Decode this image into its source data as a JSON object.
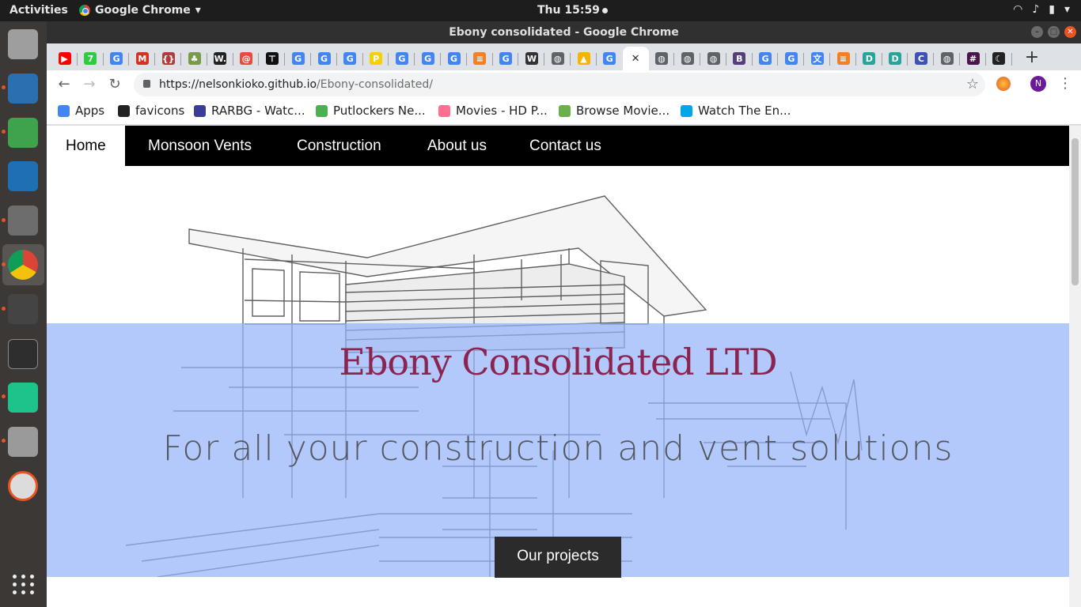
{
  "system": {
    "activities": "Activities",
    "app_name": "Google Chrome",
    "clock": "Thu 15:59"
  },
  "window": {
    "title": "Ebony consolidated - Google Chrome"
  },
  "tabs": [
    {
      "icon": "youtube-icon",
      "color": "#ff0000",
      "glyph": "▶"
    },
    {
      "icon": "green-7-icon",
      "color": "#2ecc40",
      "glyph": "7"
    },
    {
      "icon": "google-icon",
      "color": "#4285f4",
      "glyph": "G"
    },
    {
      "icon": "gmail-icon",
      "color": "#d93025",
      "glyph": "M"
    },
    {
      "icon": "code-icon",
      "color": "#b23b3b",
      "glyph": "{}"
    },
    {
      "icon": "tree-icon",
      "color": "#7a9a4b",
      "glyph": "♣"
    },
    {
      "icon": "w-icon",
      "color": "#222222",
      "glyph": "W."
    },
    {
      "icon": "spiral-icon",
      "color": "#e74c3c",
      "glyph": "@"
    },
    {
      "icon": "network-icon",
      "color": "#111111",
      "glyph": "⊤"
    },
    {
      "icon": "google-icon",
      "color": "#4285f4",
      "glyph": "G"
    },
    {
      "icon": "google-icon",
      "color": "#4285f4",
      "glyph": "G"
    },
    {
      "icon": "google-icon",
      "color": "#4285f4",
      "glyph": "G"
    },
    {
      "icon": "p-icon",
      "color": "#f7d000",
      "glyph": "P"
    },
    {
      "icon": "google-icon",
      "color": "#4285f4",
      "glyph": "G"
    },
    {
      "icon": "google-icon",
      "color": "#4285f4",
      "glyph": "G"
    },
    {
      "icon": "google-icon",
      "color": "#4285f4",
      "glyph": "G"
    },
    {
      "icon": "stackoverflow-icon",
      "color": "#f48024",
      "glyph": "≡"
    },
    {
      "icon": "google-icon",
      "color": "#4285f4",
      "glyph": "G"
    },
    {
      "icon": "wikipedia-icon",
      "color": "#333333",
      "glyph": "W"
    },
    {
      "icon": "globe-icon",
      "color": "#5f6368",
      "glyph": "◍"
    },
    {
      "icon": "drive-icon",
      "color": "#f4b400",
      "glyph": "▲"
    },
    {
      "icon": "google-icon",
      "color": "#4285f4",
      "glyph": "G"
    },
    {
      "icon": "close-tab-icon",
      "color": "#333333",
      "glyph": "✕",
      "active": true
    },
    {
      "icon": "globe-icon",
      "color": "#5f6368",
      "glyph": "◍"
    },
    {
      "icon": "globe-icon",
      "color": "#5f6368",
      "glyph": "◍"
    },
    {
      "icon": "globe-icon",
      "color": "#5f6368",
      "glyph": "◍"
    },
    {
      "icon": "bootstrap-icon",
      "color": "#563d7c",
      "glyph": "B"
    },
    {
      "icon": "google-icon",
      "color": "#4285f4",
      "glyph": "G"
    },
    {
      "icon": "google-icon",
      "color": "#4285f4",
      "glyph": "G"
    },
    {
      "icon": "translate-icon",
      "color": "#4285f4",
      "glyph": "文"
    },
    {
      "icon": "stackoverflow-icon",
      "color": "#f48024",
      "glyph": "≡"
    },
    {
      "icon": "d-icon",
      "color": "#26a69a",
      "glyph": "D"
    },
    {
      "icon": "d-icon",
      "color": "#26a69a",
      "glyph": "D"
    },
    {
      "icon": "c-icon",
      "color": "#3f51b5",
      "glyph": "C"
    },
    {
      "icon": "globe-icon",
      "color": "#5f6368",
      "glyph": "◍"
    },
    {
      "icon": "slack-icon",
      "color": "#4a154b",
      "glyph": "#"
    },
    {
      "icon": "moon-icon",
      "color": "#222222",
      "glyph": "☾"
    }
  ],
  "toolbar": {
    "url_host": "https://nelsonkioko.github.io",
    "url_path": "/Ebony-consolidated/",
    "profile_initial": "N"
  },
  "bookmarks": [
    {
      "label": "Apps",
      "color": "#4285f4"
    },
    {
      "label": "favicons",
      "color": "#222222"
    },
    {
      "label": "RARBG - Watc...",
      "color": "#3b3b98"
    },
    {
      "label": "Putlockers Ne...",
      "color": "#4caf50"
    },
    {
      "label": "Movies - HD P...",
      "color": "#ff6f91"
    },
    {
      "label": "Browse Movie...",
      "color": "#6ab04c"
    },
    {
      "label": "Watch The En...",
      "color": "#00a8e8"
    }
  ],
  "site": {
    "nav": [
      "Home",
      "Monsoon Vents",
      "Construction",
      "About us",
      "Contact us"
    ],
    "hero_title": "Ebony Consolidated LTD",
    "hero_subtitle": "For all your construction and vent solutions",
    "cta_label": "Our projects"
  },
  "colors": {
    "band": "#96b4fa",
    "title": "#8b2450",
    "nav_bg": "#000000"
  }
}
